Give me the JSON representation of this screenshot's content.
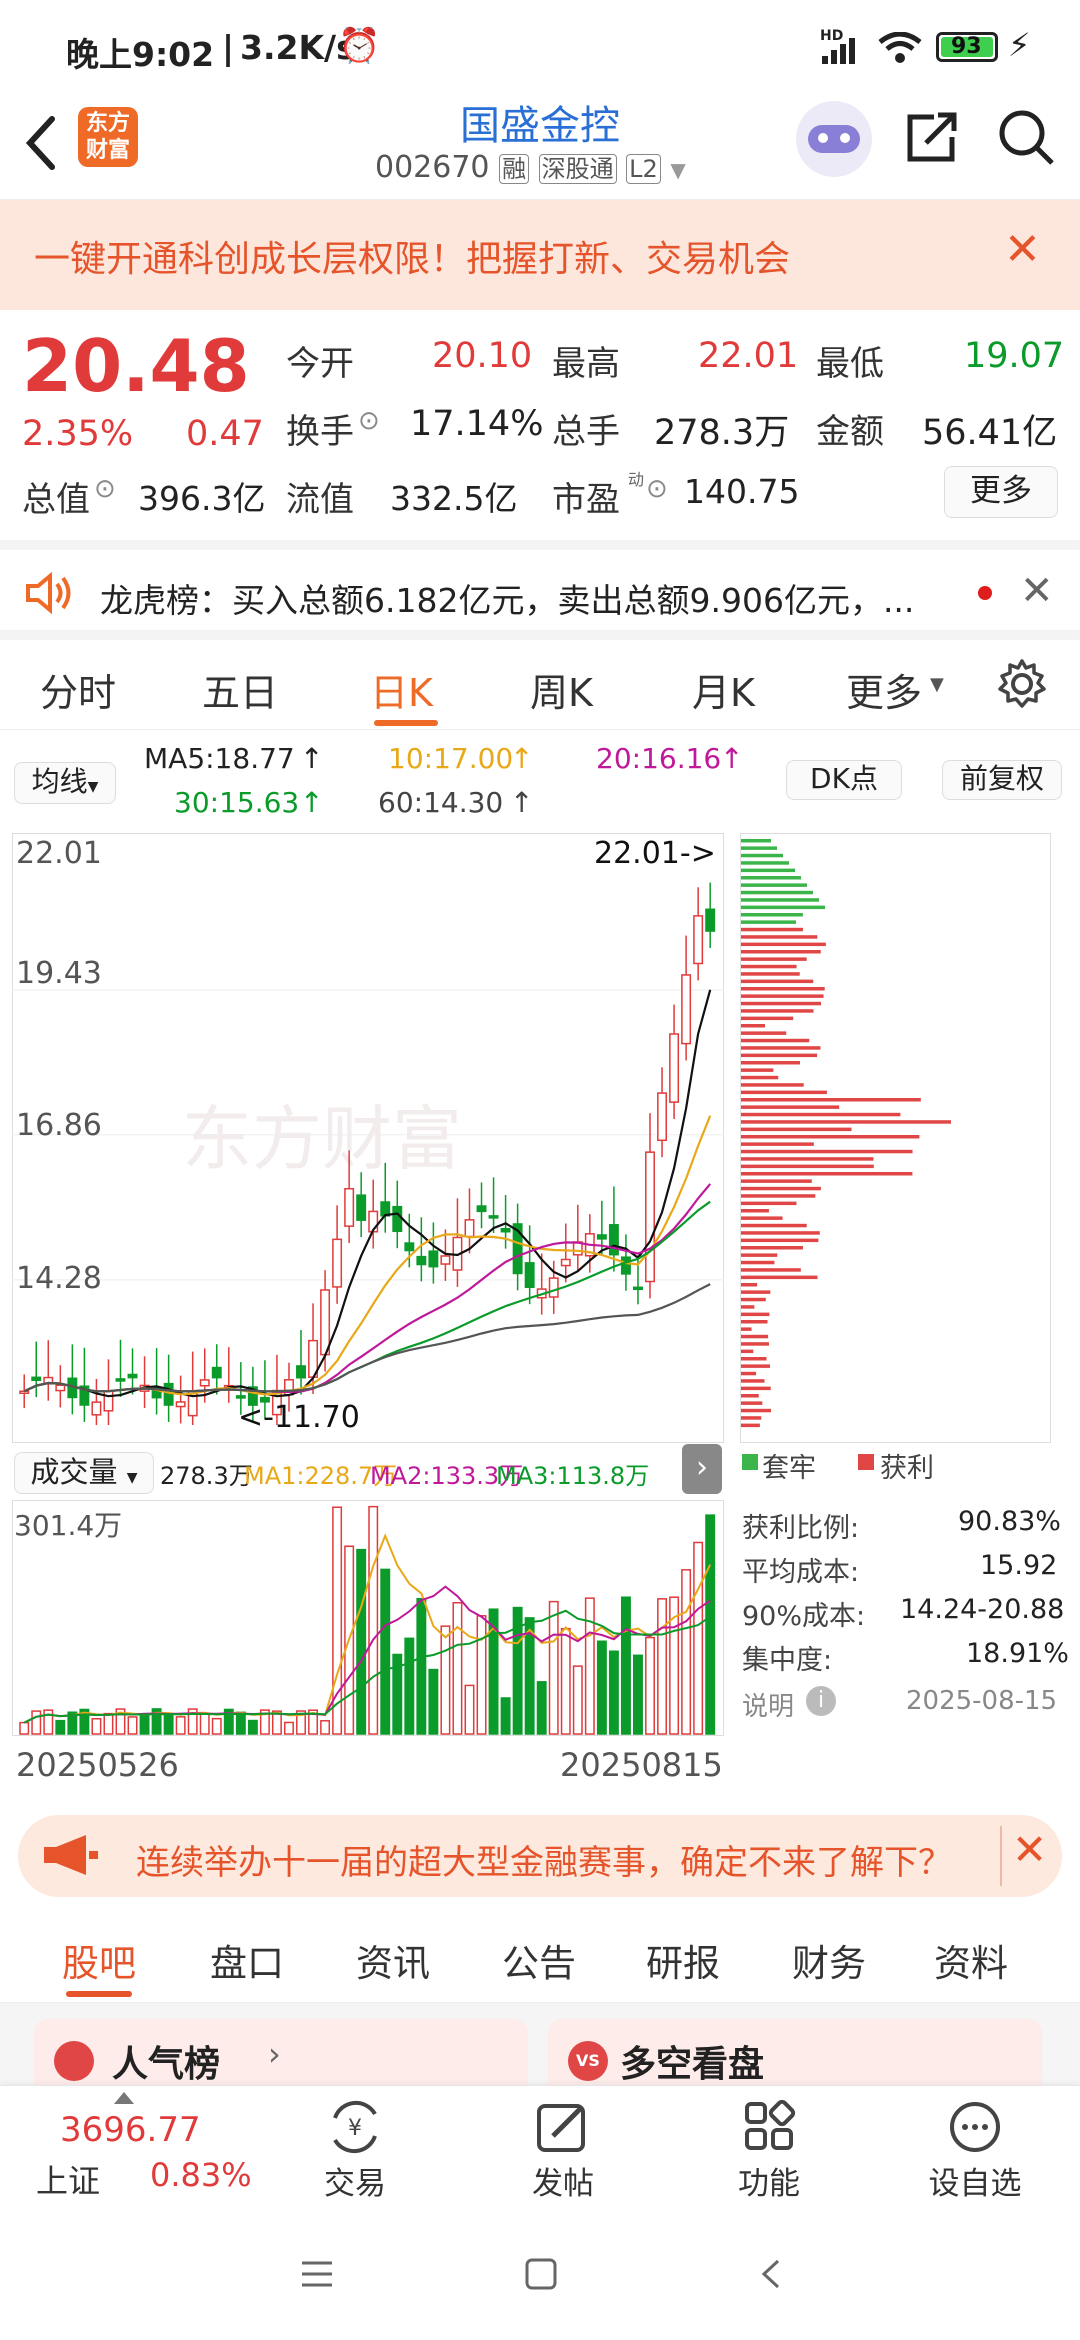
{
  "status": {
    "time": "晚上9:02",
    "speed": "3.2K/s",
    "battery": "93",
    "net": "HD"
  },
  "header": {
    "title": "国盛金控",
    "code": "002670",
    "tag1": "融",
    "tag2": "深股通",
    "tag3": "L2",
    "logo_line1": "东方",
    "logo_line2": "财富"
  },
  "banner": {
    "text": "一键开通科创成长层权限！把握打新、交易机会"
  },
  "quote": {
    "price": "20.48",
    "pct": "2.35%",
    "chg": "0.47",
    "open_label": "今开",
    "open": "20.10",
    "high_label": "最高",
    "high": "22.01",
    "low_label": "最低",
    "low": "19.07",
    "turnover_label": "换手",
    "turnover": "17.14%",
    "volume_label": "总手",
    "volume": "278.3万",
    "amount_label": "金额",
    "amount": "56.41亿",
    "mcap_label": "总值",
    "mcap": "396.3亿",
    "float_label": "流值",
    "float": "332.5亿",
    "pe_label": "市盈",
    "pe_sup": "动",
    "pe": "140.75",
    "more": "更多"
  },
  "news": {
    "text": "龙虎榜：买入总额6.182亿元，卖出总额9.906亿元，..."
  },
  "tabs": [
    "分时",
    "五日",
    "日K",
    "周K",
    "月K",
    "更多"
  ],
  "chart_bar": {
    "ma_select": "均线",
    "ma5": "MA5:18.77",
    "ma10": "10:17.00",
    "ma20": "20:16.16",
    "ma30": "30:15.63",
    "ma60": "60:14.30",
    "dk": "DK点",
    "adjust": "前复权"
  },
  "kchart": {
    "y_labels": [
      "22.01",
      "19.43",
      "16.86",
      "14.28",
      "11.70"
    ],
    "high_marker": "22.01->",
    "low_marker": "<-11.70",
    "watermark": "东方财富"
  },
  "volume_bar": {
    "select": "成交量",
    "vol": "278.3万",
    "ma1": "MA1:228.7万",
    "ma2": "MA2:133.3万",
    "ma3": "MA3:113.8万",
    "max": "301.4万"
  },
  "dates": {
    "start": "20250526",
    "end": "20250815"
  },
  "chip": {
    "legend_trapped": "套牢",
    "legend_profit": "获利",
    "profit_ratio_label": "获利比例:",
    "profit_ratio": "90.83%",
    "avg_cost_label": "平均成本:",
    "avg_cost": "15.92",
    "cost90_label": "90%成本:",
    "cost90": "14.24-20.88",
    "concentration_label": "集中度:",
    "concentration": "18.91%",
    "note_label": "说明",
    "date": "2025-08-15"
  },
  "ad": {
    "text": "连续举办十一届的超大型金融赛事，确定不来了解下？"
  },
  "subtabs": [
    "股吧",
    "盘口",
    "资讯",
    "公告",
    "研报",
    "财务",
    "资料"
  ],
  "cards": {
    "left": "人气榜",
    "right": "多空看盘"
  },
  "bottom": {
    "index_value": "3696.77",
    "index_name": "上证",
    "index_pct": "0.83%",
    "trade": "交易",
    "post": "发帖",
    "func": "功能",
    "watch": "设自选"
  },
  "colors": {
    "up": "#e03a3a",
    "down": "#0a9b2a",
    "accent": "#ef6a26",
    "banner_bg": "#fde6dc"
  }
}
